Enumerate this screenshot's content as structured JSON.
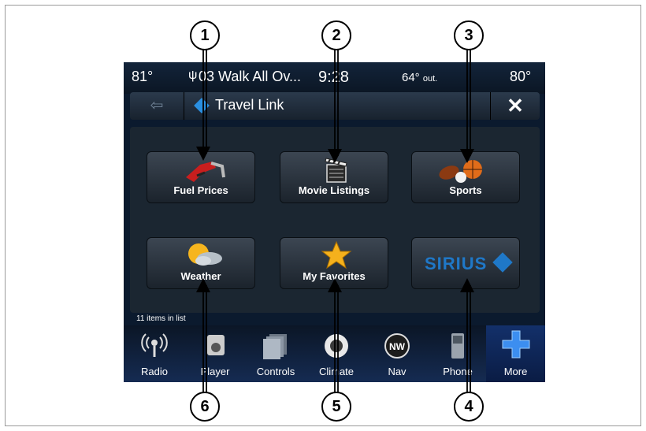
{
  "status": {
    "temp_left": "81°",
    "media": "03 Walk All Ov...",
    "time": "9:28",
    "outside_temp": "64°",
    "outside_label": "out.",
    "temp_right": "80°"
  },
  "header": {
    "back_icon": "back-arrow-icon",
    "title": "Travel Link",
    "close_label": "✕"
  },
  "tiles": [
    {
      "label": "Fuel Prices",
      "icon": "fuel-nozzle-icon"
    },
    {
      "label": "Movie Listings",
      "icon": "clapperboard-icon"
    },
    {
      "label": "Sports",
      "icon": "sports-balls-icon"
    },
    {
      "label": "Weather",
      "icon": "sun-cloud-icon"
    },
    {
      "label": "My Favorites",
      "icon": "star-icon"
    },
    {
      "label": "SIRIUS",
      "icon": "sirius-logo-icon"
    }
  ],
  "list_count": "11 items in list",
  "dock": [
    {
      "label": "Radio",
      "icon": "radio-icon"
    },
    {
      "label": "Player",
      "icon": "player-icon"
    },
    {
      "label": "Controls",
      "icon": "controls-icon"
    },
    {
      "label": "Climate",
      "icon": "climate-icon"
    },
    {
      "label": "Nav",
      "icon": "compass-icon",
      "badge": "NW"
    },
    {
      "label": "Phone",
      "icon": "phone-icon"
    },
    {
      "label": "More",
      "icon": "plus-icon"
    }
  ],
  "callouts": [
    "1",
    "2",
    "3",
    "4",
    "5",
    "6"
  ],
  "colors": {
    "accent": "#2a8fe0",
    "screen_bg": "#0b1a2e",
    "star": "#f5b11c",
    "sirius_blue": "#1f78c8"
  }
}
